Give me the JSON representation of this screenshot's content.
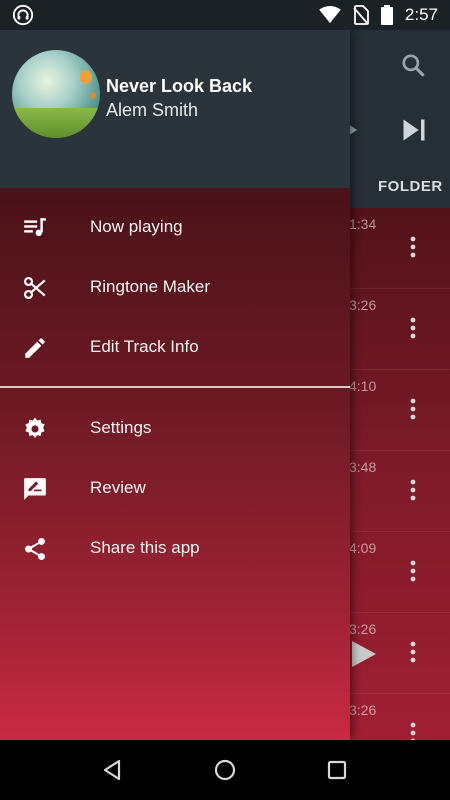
{
  "status_bar": {
    "time": "2:57",
    "icons": [
      "headset-icon",
      "wifi-icon",
      "no-sim-icon",
      "battery-icon"
    ]
  },
  "background": {
    "folder_tab": "FOLDER",
    "durations": [
      "1:34",
      "3:26",
      "4:10",
      "3:48",
      "4:09",
      "3:26",
      "3:26"
    ]
  },
  "drawer": {
    "now_playing": {
      "title": "Never Look Back",
      "artist": "Alem Smith"
    },
    "menu_group_1": [
      {
        "label": "Now playing",
        "icon": "queue-music-icon"
      },
      {
        "label": "Ringtone Maker",
        "icon": "scissors-icon"
      },
      {
        "label": "Edit Track Info",
        "icon": "pencil-icon"
      }
    ],
    "menu_group_2": [
      {
        "label": "Settings",
        "icon": "gear-icon"
      },
      {
        "label": "Review",
        "icon": "rate-review-icon"
      },
      {
        "label": "Share this app",
        "icon": "share-icon"
      }
    ]
  },
  "nav_bar": {
    "buttons": [
      "back-icon",
      "home-icon",
      "recents-icon"
    ]
  },
  "colors": {
    "header_bg": "#2b343a",
    "drawer_top": "#4a1219",
    "drawer_bottom": "#c92a43",
    "text": "#ffffff"
  }
}
